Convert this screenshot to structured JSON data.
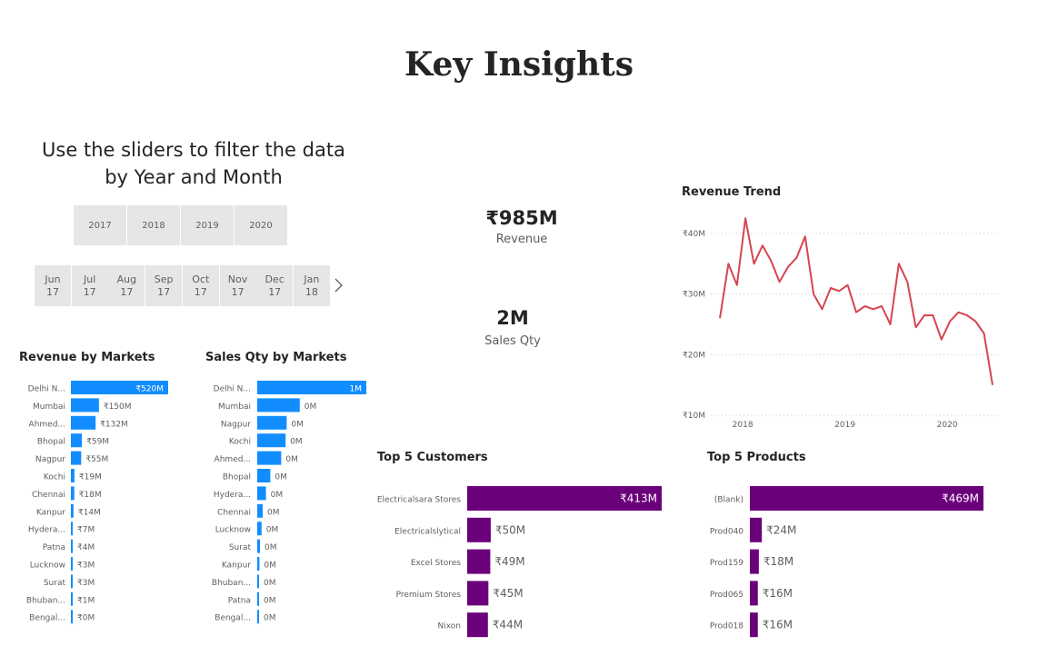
{
  "page_title": "Key Insights",
  "instructions": "Use the sliders to filter the data by Year and Month",
  "year_slicer": [
    "2017",
    "2018",
    "2019",
    "2020"
  ],
  "month_slicer": [
    {
      "month": "Jun",
      "year": "17"
    },
    {
      "month": "Jul",
      "year": "17"
    },
    {
      "month": "Aug",
      "year": "17"
    },
    {
      "month": "Sep",
      "year": "17"
    },
    {
      "month": "Oct",
      "year": "17"
    },
    {
      "month": "Nov",
      "year": "17"
    },
    {
      "month": "Dec",
      "year": "17"
    },
    {
      "month": "Jan",
      "year": "18"
    }
  ],
  "icons": {
    "month_next": "chevron-right-icon"
  },
  "kpis": {
    "revenue": {
      "value": "₹985M",
      "label": "Revenue"
    },
    "sales_qty": {
      "value": "2M",
      "label": "Sales Qty"
    }
  },
  "colors": {
    "markets_bar": "#118dff",
    "top5_bar": "#6b007b",
    "trend_line": "#d64550"
  },
  "chart_data": [
    {
      "id": "revenue_by_markets",
      "type": "bar",
      "orientation": "horizontal",
      "title": "Revenue by Markets",
      "categories": [
        "Delhi N...",
        "Mumbai",
        "Ahmed...",
        "Bhopal",
        "Nagpur",
        "Kochi",
        "Chennai",
        "Kanpur",
        "Hydera...",
        "Patna",
        "Lucknow",
        "Surat",
        "Bhuban...",
        "Bengal..."
      ],
      "values": [
        520,
        150,
        132,
        59,
        55,
        19,
        18,
        14,
        7,
        4,
        3,
        3,
        1,
        0
      ],
      "labels": [
        "₹520M",
        "₹150M",
        "₹132M",
        "₹59M",
        "₹55M",
        "₹19M",
        "₹18M",
        "₹14M",
        "₹7M",
        "₹4M",
        "₹3M",
        "₹3M",
        "₹1M",
        "₹0M"
      ],
      "unit": "₹M"
    },
    {
      "id": "sales_qty_by_markets",
      "type": "bar",
      "orientation": "horizontal",
      "title": "Sales Qty by Markets",
      "categories": [
        "Delhi N...",
        "Mumbai",
        "Nagpur",
        "Kochi",
        "Ahmed...",
        "Bhopal",
        "Hydera...",
        "Chennai",
        "Lucknow",
        "Surat",
        "Kanpur",
        "Bhuban...",
        "Patna",
        "Bengal..."
      ],
      "values": [
        1.0,
        0.39,
        0.27,
        0.26,
        0.22,
        0.12,
        0.08,
        0.05,
        0.04,
        0.025,
        0.02,
        0.015,
        0.01,
        0.005
      ],
      "labels": [
        "1M",
        "0M",
        "0M",
        "0M",
        "0M",
        "0M",
        "0M",
        "0M",
        "0M",
        "0M",
        "0M",
        "0M",
        "0M",
        "0M"
      ],
      "unit": "M"
    },
    {
      "id": "revenue_trend",
      "type": "line",
      "title": "Revenue Trend",
      "x_ticks": [
        "2018",
        "2019",
        "2020"
      ],
      "y_ticks": [
        "₹10M",
        "₹20M",
        "₹30M",
        "₹40M"
      ],
      "ylim": [
        10,
        40
      ],
      "grid": true,
      "y": [
        26,
        35,
        31.5,
        42.5,
        35,
        38,
        35.5,
        32,
        34.5,
        36,
        39.5,
        30,
        27.5,
        31,
        30.5,
        31.5,
        27,
        28,
        27.5,
        28,
        25,
        35,
        32,
        24.5,
        26.5,
        26.5,
        22.5,
        25.5,
        27,
        26.5,
        25.5,
        23.5,
        15
      ],
      "unit": "₹M"
    },
    {
      "id": "top5_customers",
      "type": "bar",
      "orientation": "horizontal",
      "title": "Top 5 Customers",
      "categories": [
        "Electricalsara Stores",
        "Electricalslytical",
        "Excel Stores",
        "Premium Stores",
        "Nixon"
      ],
      "values": [
        413,
        50,
        49,
        45,
        44
      ],
      "labels": [
        "₹413M",
        "₹50M",
        "₹49M",
        "₹45M",
        "₹44M"
      ],
      "unit": "₹M"
    },
    {
      "id": "top5_products",
      "type": "bar",
      "orientation": "horizontal",
      "title": "Top 5 Products",
      "categories": [
        "(Blank)",
        "Prod040",
        "Prod159",
        "Prod065",
        "Prod018"
      ],
      "values": [
        469,
        24,
        18,
        16,
        16
      ],
      "labels": [
        "₹469M",
        "₹24M",
        "₹18M",
        "₹16M",
        "₹16M"
      ],
      "unit": "₹M"
    }
  ]
}
